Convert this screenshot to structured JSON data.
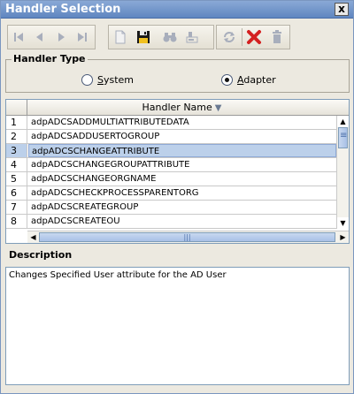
{
  "window": {
    "title": "Handler Selection",
    "close_label": "x"
  },
  "toolbar": {
    "buttons": [
      {
        "name": "first-record",
        "icon": "first-icon"
      },
      {
        "name": "previous-record",
        "icon": "previous-icon"
      },
      {
        "name": "next-record",
        "icon": "next-icon"
      },
      {
        "name": "last-record",
        "icon": "last-icon"
      },
      {
        "name": "new",
        "icon": "new-document-icon"
      },
      {
        "name": "save",
        "icon": "save-icon"
      },
      {
        "name": "find",
        "icon": "binoculars-icon"
      },
      {
        "name": "clear",
        "icon": "eraser-icon"
      },
      {
        "name": "refresh",
        "icon": "refresh-icon"
      },
      {
        "name": "delete",
        "icon": "red-x-icon"
      },
      {
        "name": "trash",
        "icon": "trash-icon"
      }
    ]
  },
  "handler_type": {
    "legend": "Handler Type",
    "options": [
      {
        "label_first": "S",
        "label_rest": "ystem",
        "selected": false
      },
      {
        "label_first": "A",
        "label_rest": "dapter",
        "selected": true
      }
    ]
  },
  "table": {
    "column_header": "Handler Name",
    "sort_icon": "▼",
    "rows": [
      {
        "num": "1",
        "name": "adpADCSADDMULTIATTRIBUTEDATA",
        "selected": false
      },
      {
        "num": "2",
        "name": "adpADCSADDUSERTOGROUP",
        "selected": false
      },
      {
        "num": "3",
        "name": "adpADCSCHANGEATTRIBUTE",
        "selected": true
      },
      {
        "num": "4",
        "name": "adpADCSCHANGEGROUPATTRIBUTE",
        "selected": false
      },
      {
        "num": "5",
        "name": "adpADCSCHANGEORGNAME",
        "selected": false
      },
      {
        "num": "6",
        "name": "adpADCSCHECKPROCESSPARENTORG",
        "selected": false
      },
      {
        "num": "7",
        "name": "adpADCSCREATEGROUP",
        "selected": false
      },
      {
        "num": "8",
        "name": "adpADCSCREATEOU",
        "selected": false
      }
    ]
  },
  "description": {
    "legend": "Description",
    "text": "Changes Specified User attribute for the AD User"
  },
  "colors": {
    "titlebar": "#5f86c0",
    "selection": "#bcd0ea",
    "delete_red": "#d42020",
    "background": "#ece9e0"
  }
}
